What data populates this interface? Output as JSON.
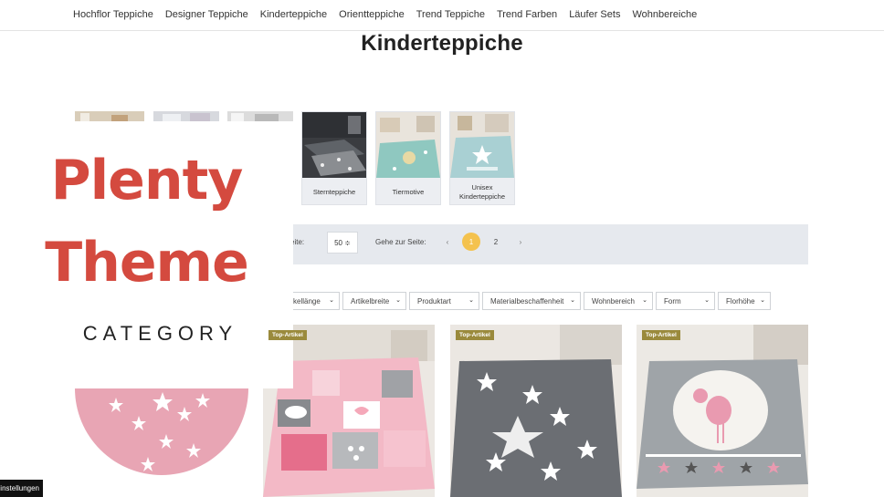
{
  "nav": {
    "items": [
      "Hochflor Teppiche",
      "Designer Teppiche",
      "Kinderteppiche",
      "Orientteppiche",
      "Trend Teppiche",
      "Trend Farben",
      "Läufer Sets",
      "Wohnbereiche"
    ]
  },
  "page_title": "Kinderteppiche",
  "subcategories": [
    {
      "label": "Sternteppiche"
    },
    {
      "label": "Tiermotive"
    },
    {
      "label": "Unisex Kinderteppiche"
    }
  ],
  "toolbar": {
    "per_page_label": "eite:",
    "per_page_value": "50 ≑",
    "goto_label": "Gehe zur Seite:",
    "prev": "‹",
    "pages": [
      "1",
      "2"
    ],
    "current_page": "1",
    "next": "›"
  },
  "filters": [
    "kellänge",
    "Artikelbreite",
    "Produktart",
    "Materialbeschaffenheit",
    "Wohnbereich",
    "Form",
    "Florhöhe"
  ],
  "products": [
    {
      "badge": "Top-Artikel"
    },
    {
      "badge": "Top-Artikel"
    },
    {
      "badge": "Top-Artikel"
    }
  ],
  "promo": {
    "line1": "Plenty",
    "line2": "Theme",
    "line3": "CATEGORY"
  },
  "cookie_button": "instellungen",
  "colors": {
    "accent": "#f4c24e",
    "promo_red": "#d44a3f",
    "badge": "#9a8a3c",
    "toolbar_bg": "#e6e9ee"
  }
}
